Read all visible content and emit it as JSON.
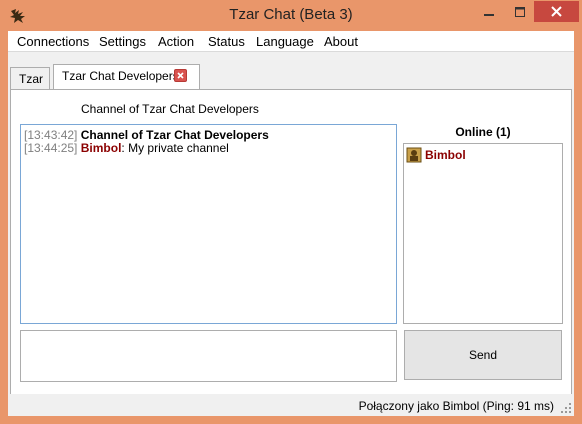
{
  "window": {
    "title": "Tzar Chat (Beta 3)",
    "app_icon": "tzar-app-icon",
    "controls": [
      "minimize-icon",
      "maximize-icon",
      "close-icon"
    ],
    "accent_color": "#e9966a",
    "close_color": "#c7483f"
  },
  "menu": {
    "items": [
      "Connections",
      "Settings",
      "Action",
      "Status",
      "Language",
      "About"
    ]
  },
  "tabs": [
    {
      "label": "Tzar",
      "active": false
    },
    {
      "label": "Tzar Chat Developers",
      "active": true,
      "closable": true
    }
  ],
  "channel": {
    "title": "Channel of Tzar Chat Developers"
  },
  "log": [
    {
      "time": "[13:43:42]",
      "user": "",
      "text": "Channel of Tzar Chat Developers"
    },
    {
      "time": "[13:44:25]",
      "user": "Bimbol",
      "text": " My private channel"
    }
  ],
  "online": {
    "label": "Online (1)",
    "users": [
      {
        "name": "Bimbol",
        "icon": "user-avatar-icon"
      }
    ]
  },
  "compose": {
    "value": "",
    "send_label": "Send"
  },
  "status": {
    "text": "Połączony jako Bimbol  (Ping: 91 ms)"
  }
}
